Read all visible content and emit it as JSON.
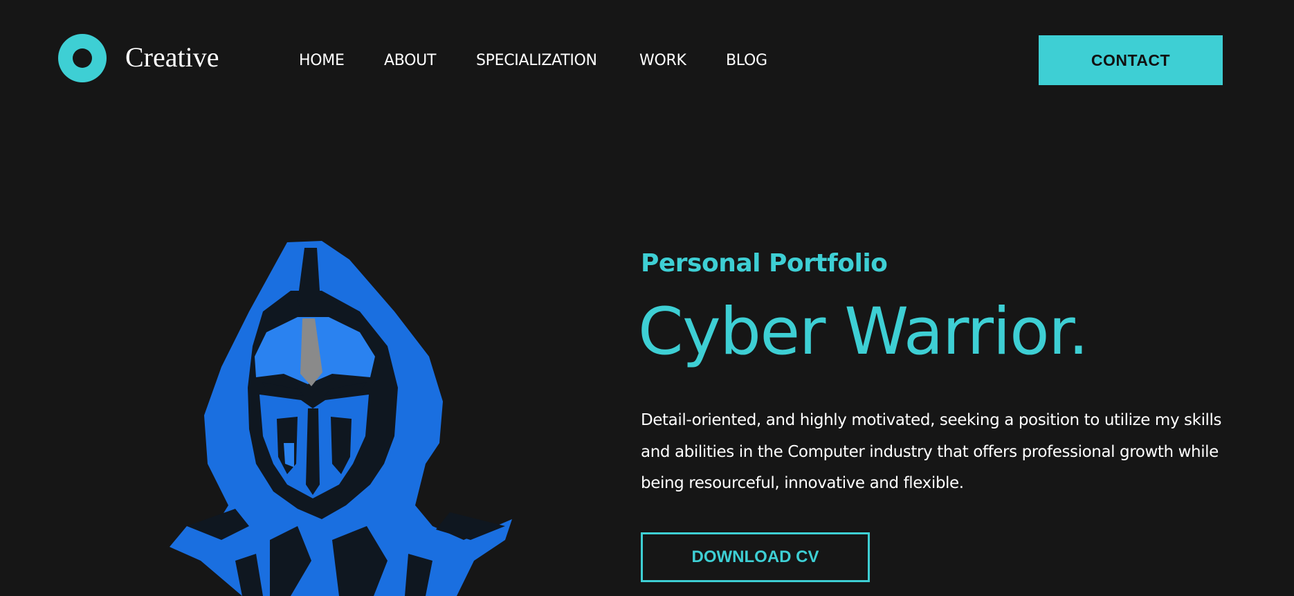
{
  "brand": {
    "logo_icon": "ring-logo-icon",
    "name": "Creative"
  },
  "nav": {
    "items": [
      {
        "label": "HOME"
      },
      {
        "label": "ABOUT"
      },
      {
        "label": "SPECIALIZATION"
      },
      {
        "label": "WORK"
      },
      {
        "label": "BLOG"
      }
    ]
  },
  "header": {
    "contact_label": "CONTACT"
  },
  "hero": {
    "eyebrow": "Personal Portfolio",
    "title": "Cyber Warrior.",
    "description": "Detail-oriented, and highly motivated, seeking a position to utilize my skills and abilities in the Computer industry that offers professional growth while being resourceful, innovative and flexible.",
    "download_label": "DOWNLOAD CV",
    "image_icon": "hooded-warrior-illustration"
  },
  "colors": {
    "background": "#161616",
    "accent": "#3ecfd4",
    "illustration_blue": "#1a6fe0",
    "text": "#ffffff"
  }
}
